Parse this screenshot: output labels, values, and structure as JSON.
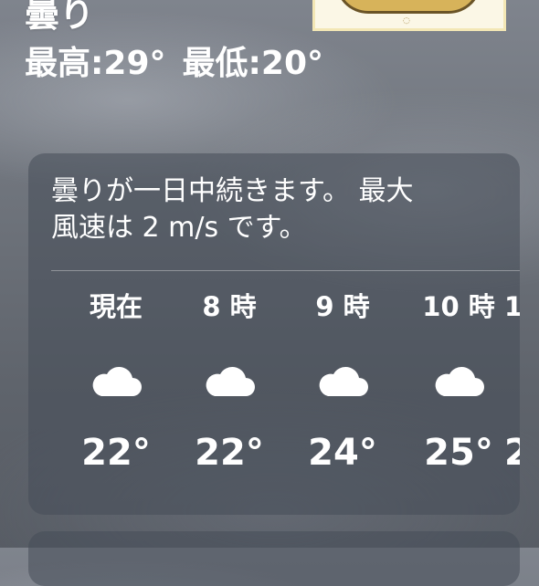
{
  "header": {
    "condition": "曇り",
    "high": "最高:29°",
    "low": "最低:20°"
  },
  "forecast_card": {
    "summary_line1": "曇りが一日中続きます。 最大",
    "summary_line2": "風速は 2 m/s です。",
    "icon": "cloud-icon",
    "hours": [
      {
        "label": "現在",
        "temp": "22°"
      },
      {
        "label": "8 時",
        "temp": "22°"
      },
      {
        "label": "9 時",
        "temp": "24°"
      },
      {
        "label": "10 時",
        "temp": "25°"
      },
      {
        "label": "1",
        "temp": "2"
      }
    ]
  }
}
